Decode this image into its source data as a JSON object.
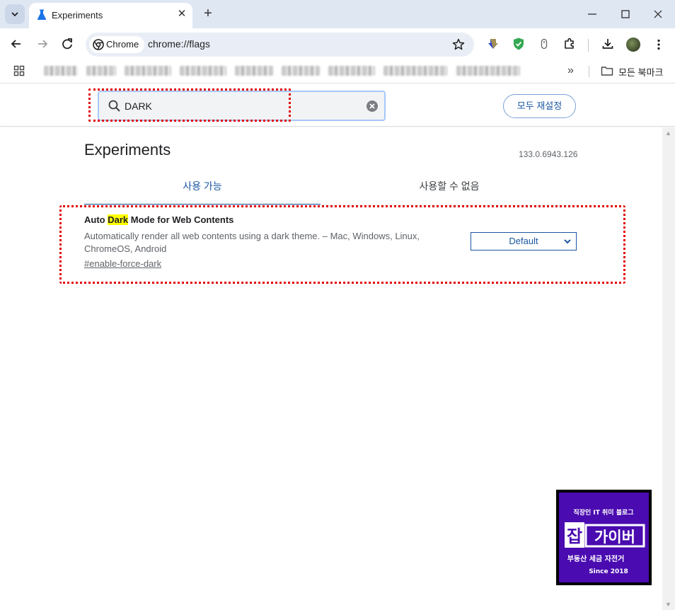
{
  "browser": {
    "tab": {
      "title": "Experiments"
    },
    "omnibox": {
      "chip_label": "Chrome",
      "url": "chrome://flags"
    },
    "bookmarks": {
      "all_bookmarks_label": "모든 북마크"
    }
  },
  "header": {
    "search": {
      "value": "DARK"
    },
    "reset_all_label": "모두 재설정"
  },
  "main": {
    "title": "Experiments",
    "version": "133.0.6943.126",
    "tabs": [
      {
        "label": "사용 가능",
        "active": true
      },
      {
        "label": "사용할 수 없음",
        "active": false
      }
    ],
    "flags": [
      {
        "name_before": "Auto ",
        "name_highlight": "Dark",
        "name_after": " Mode for Web Contents",
        "description": "Automatically render all web contents using a dark theme. – Mac, Windows, Linux, ChromeOS, Android",
        "link": "#enable-force-dark",
        "selected_value": "Default"
      }
    ]
  },
  "watermark": {
    "tagline": "직장인 IT 취미 블로그",
    "brand_prefix": "잡",
    "brand_name": "가이버",
    "subtitle": "부동산 세금 자전거",
    "since": "Since 2018"
  },
  "colors": {
    "accent": "#1a56a0",
    "annotation_red": "#e00000",
    "highlight": "#ffff00",
    "logo_purple": "#4a0bb0"
  }
}
